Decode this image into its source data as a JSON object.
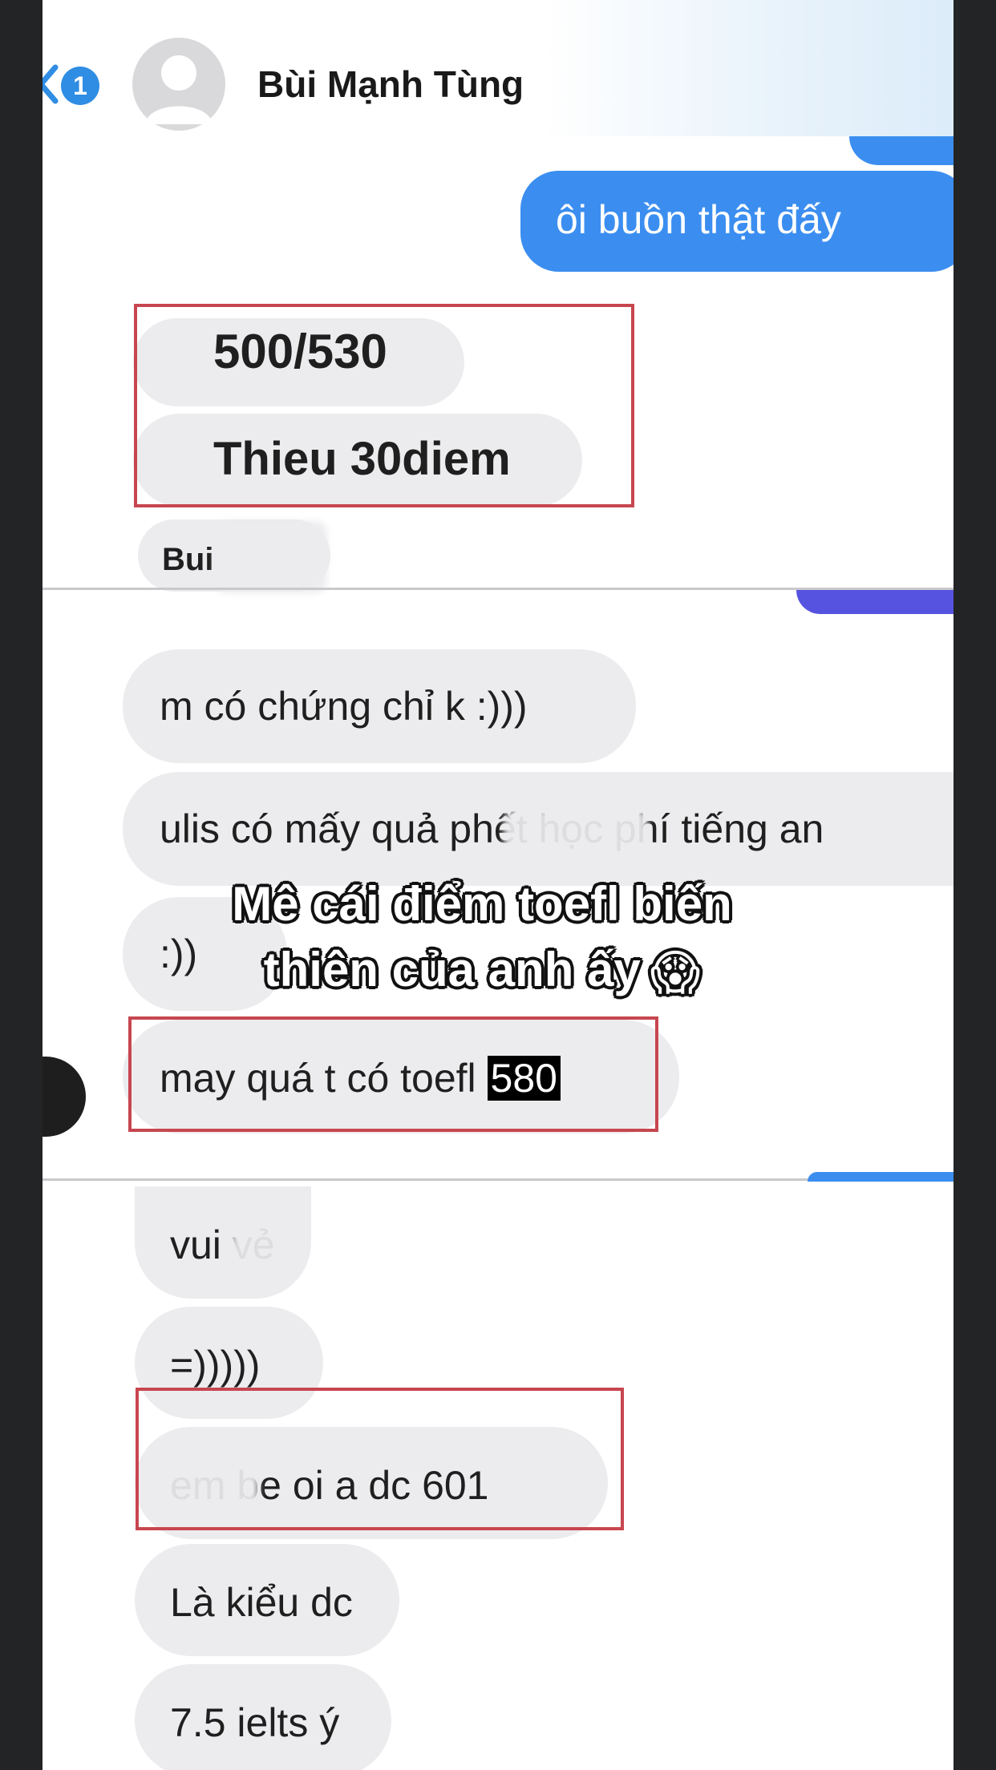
{
  "header": {
    "unread_count": "1",
    "contact_name": "Bùi Mạnh Tùng"
  },
  "messages": {
    "sent_1": "ôi buồn thật đấy",
    "score": "500/530",
    "missing": "Thieu 30diem",
    "partial_1": "Bui",
    "cert_question": "m có chứng chỉ k :)))",
    "ulis_fee": "ulis có mấy quả phết học phí tiếng an",
    "smile": ":))",
    "toefl_prefix": "may quá t có toefl ",
    "toefl_score": "580",
    "vui": "vui vẻ",
    "laugh": "=)))))",
    "em_be": "em be oi a dc 601",
    "la_kieu": "Là kiểu dc",
    "ielts": "7.5 ielts ý"
  },
  "caption": {
    "line1": "Mê cái điểm toefl biến",
    "line2": "thiên của anh ấy",
    "emoji": "😱"
  },
  "colors": {
    "outgoing_bubble": "#3b8ef0",
    "incoming_bubble": "#ececee",
    "highlight_box": "#c7464f",
    "badge": "#2f8de4"
  }
}
